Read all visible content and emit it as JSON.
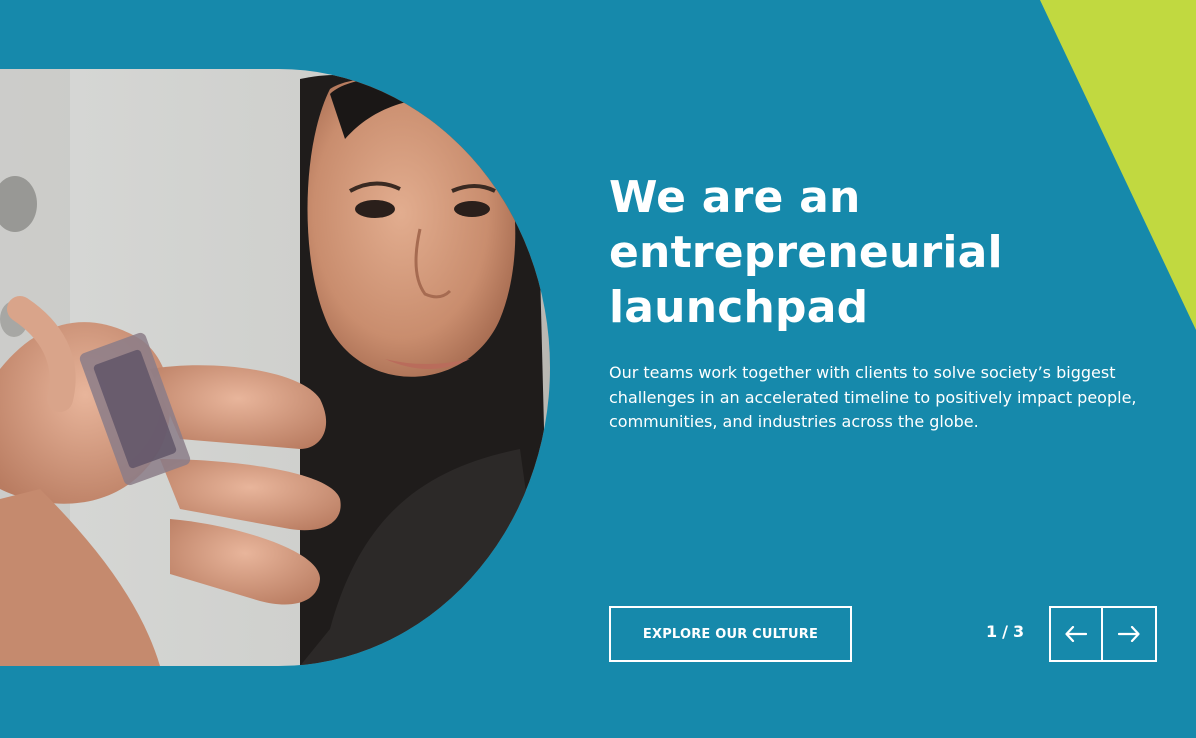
{
  "colors": {
    "background": "#1689ab",
    "accent": "#c1d940",
    "text": "#ffffff"
  },
  "hero": {
    "headline": "We are an\nentrepreneurial\nlaunchpad",
    "description": "Our teams work together with clients to solve society’s biggest challenges in an accelerated timeline to positively impact people, communities, and industries across the globe.",
    "cta_label": "EXPLORE OUR CULTURE"
  },
  "carousel": {
    "current": "1",
    "separator": "/",
    "total": "3",
    "prev_icon": "arrow-left-icon",
    "next_icon": "arrow-right-icon"
  }
}
